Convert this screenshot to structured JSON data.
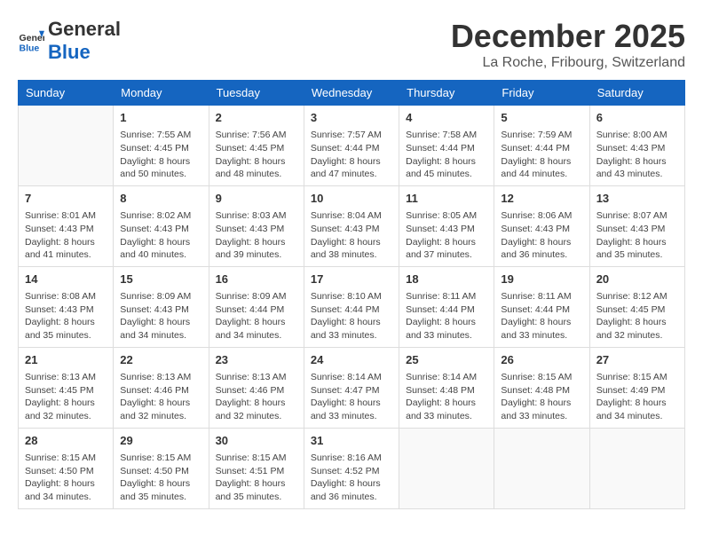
{
  "header": {
    "logo_general": "General",
    "logo_blue": "Blue",
    "month_title": "December 2025",
    "location": "La Roche, Fribourg, Switzerland"
  },
  "weekdays": [
    "Sunday",
    "Monday",
    "Tuesday",
    "Wednesday",
    "Thursday",
    "Friday",
    "Saturday"
  ],
  "weeks": [
    [
      {
        "day": "",
        "info": ""
      },
      {
        "day": "1",
        "info": "Sunrise: 7:55 AM\nSunset: 4:45 PM\nDaylight: 8 hours\nand 50 minutes."
      },
      {
        "day": "2",
        "info": "Sunrise: 7:56 AM\nSunset: 4:45 PM\nDaylight: 8 hours\nand 48 minutes."
      },
      {
        "day": "3",
        "info": "Sunrise: 7:57 AM\nSunset: 4:44 PM\nDaylight: 8 hours\nand 47 minutes."
      },
      {
        "day": "4",
        "info": "Sunrise: 7:58 AM\nSunset: 4:44 PM\nDaylight: 8 hours\nand 45 minutes."
      },
      {
        "day": "5",
        "info": "Sunrise: 7:59 AM\nSunset: 4:44 PM\nDaylight: 8 hours\nand 44 minutes."
      },
      {
        "day": "6",
        "info": "Sunrise: 8:00 AM\nSunset: 4:43 PM\nDaylight: 8 hours\nand 43 minutes."
      }
    ],
    [
      {
        "day": "7",
        "info": "Sunrise: 8:01 AM\nSunset: 4:43 PM\nDaylight: 8 hours\nand 41 minutes."
      },
      {
        "day": "8",
        "info": "Sunrise: 8:02 AM\nSunset: 4:43 PM\nDaylight: 8 hours\nand 40 minutes."
      },
      {
        "day": "9",
        "info": "Sunrise: 8:03 AM\nSunset: 4:43 PM\nDaylight: 8 hours\nand 39 minutes."
      },
      {
        "day": "10",
        "info": "Sunrise: 8:04 AM\nSunset: 4:43 PM\nDaylight: 8 hours\nand 38 minutes."
      },
      {
        "day": "11",
        "info": "Sunrise: 8:05 AM\nSunset: 4:43 PM\nDaylight: 8 hours\nand 37 minutes."
      },
      {
        "day": "12",
        "info": "Sunrise: 8:06 AM\nSunset: 4:43 PM\nDaylight: 8 hours\nand 36 minutes."
      },
      {
        "day": "13",
        "info": "Sunrise: 8:07 AM\nSunset: 4:43 PM\nDaylight: 8 hours\nand 35 minutes."
      }
    ],
    [
      {
        "day": "14",
        "info": "Sunrise: 8:08 AM\nSunset: 4:43 PM\nDaylight: 8 hours\nand 35 minutes."
      },
      {
        "day": "15",
        "info": "Sunrise: 8:09 AM\nSunset: 4:43 PM\nDaylight: 8 hours\nand 34 minutes."
      },
      {
        "day": "16",
        "info": "Sunrise: 8:09 AM\nSunset: 4:44 PM\nDaylight: 8 hours\nand 34 minutes."
      },
      {
        "day": "17",
        "info": "Sunrise: 8:10 AM\nSunset: 4:44 PM\nDaylight: 8 hours\nand 33 minutes."
      },
      {
        "day": "18",
        "info": "Sunrise: 8:11 AM\nSunset: 4:44 PM\nDaylight: 8 hours\nand 33 minutes."
      },
      {
        "day": "19",
        "info": "Sunrise: 8:11 AM\nSunset: 4:44 PM\nDaylight: 8 hours\nand 33 minutes."
      },
      {
        "day": "20",
        "info": "Sunrise: 8:12 AM\nSunset: 4:45 PM\nDaylight: 8 hours\nand 32 minutes."
      }
    ],
    [
      {
        "day": "21",
        "info": "Sunrise: 8:13 AM\nSunset: 4:45 PM\nDaylight: 8 hours\nand 32 minutes."
      },
      {
        "day": "22",
        "info": "Sunrise: 8:13 AM\nSunset: 4:46 PM\nDaylight: 8 hours\nand 32 minutes."
      },
      {
        "day": "23",
        "info": "Sunrise: 8:13 AM\nSunset: 4:46 PM\nDaylight: 8 hours\nand 32 minutes."
      },
      {
        "day": "24",
        "info": "Sunrise: 8:14 AM\nSunset: 4:47 PM\nDaylight: 8 hours\nand 33 minutes."
      },
      {
        "day": "25",
        "info": "Sunrise: 8:14 AM\nSunset: 4:48 PM\nDaylight: 8 hours\nand 33 minutes."
      },
      {
        "day": "26",
        "info": "Sunrise: 8:15 AM\nSunset: 4:48 PM\nDaylight: 8 hours\nand 33 minutes."
      },
      {
        "day": "27",
        "info": "Sunrise: 8:15 AM\nSunset: 4:49 PM\nDaylight: 8 hours\nand 34 minutes."
      }
    ],
    [
      {
        "day": "28",
        "info": "Sunrise: 8:15 AM\nSunset: 4:50 PM\nDaylight: 8 hours\nand 34 minutes."
      },
      {
        "day": "29",
        "info": "Sunrise: 8:15 AM\nSunset: 4:50 PM\nDaylight: 8 hours\nand 35 minutes."
      },
      {
        "day": "30",
        "info": "Sunrise: 8:15 AM\nSunset: 4:51 PM\nDaylight: 8 hours\nand 35 minutes."
      },
      {
        "day": "31",
        "info": "Sunrise: 8:16 AM\nSunset: 4:52 PM\nDaylight: 8 hours\nand 36 minutes."
      },
      {
        "day": "",
        "info": ""
      },
      {
        "day": "",
        "info": ""
      },
      {
        "day": "",
        "info": ""
      }
    ]
  ]
}
